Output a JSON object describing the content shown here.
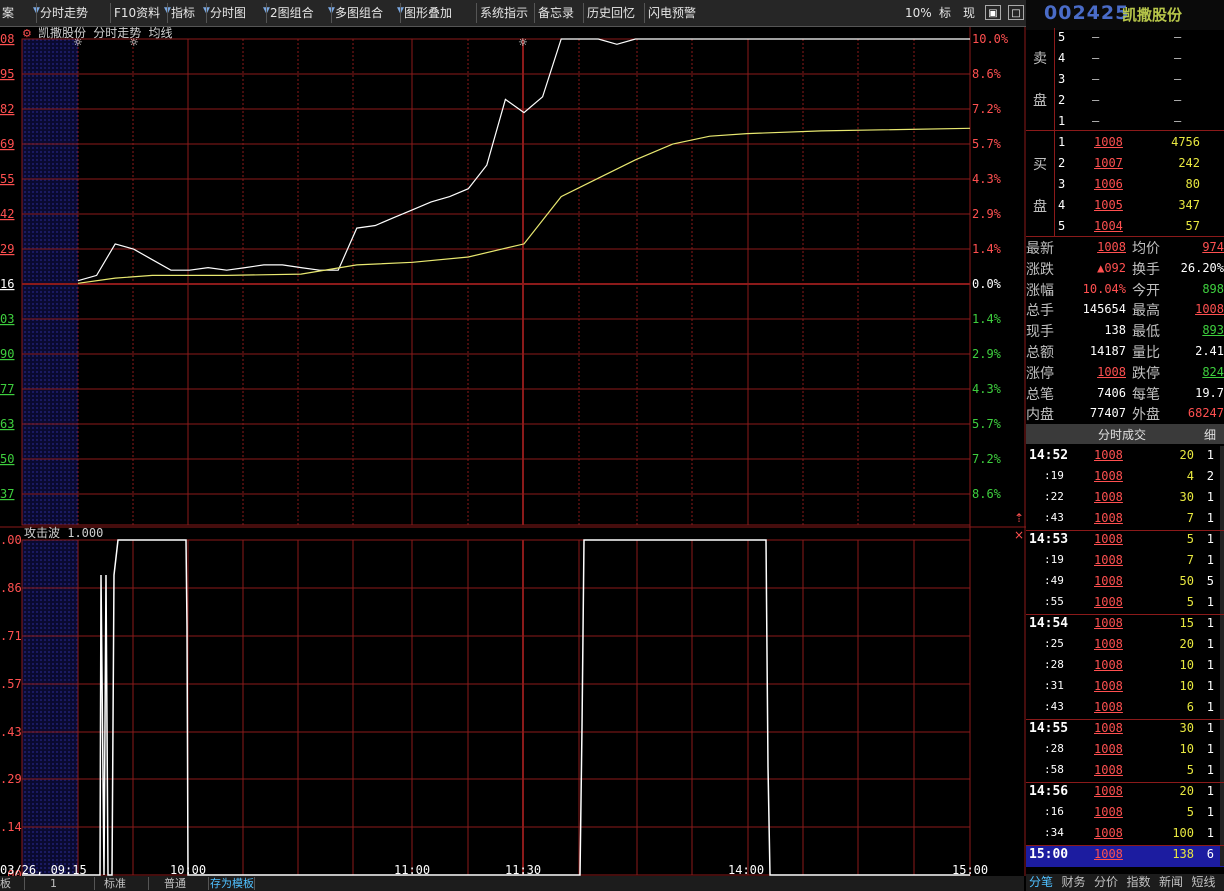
{
  "toolbar": {
    "items": [
      "案",
      "分时走势",
      "F10资料",
      "指标",
      "分时图",
      "2图组合",
      "多图组合",
      "图形叠加",
      "系统指示",
      "备忘录",
      "历史回忆",
      "闪电预警"
    ],
    "right": [
      "10%",
      "标",
      "现"
    ]
  },
  "stock": {
    "code": "002425",
    "name": "凯撒股份"
  },
  "chart": {
    "title": "凯撒股份 分时走势  均线",
    "left_prices": [
      "08",
      "95",
      "82",
      "69",
      "55",
      "42",
      "29",
      "16",
      "03",
      "90",
      "77",
      "63",
      "50",
      "37"
    ],
    "right_pcts": [
      "10.0%",
      "8.6%",
      "7.2%",
      "5.7%",
      "4.3%",
      "2.9%",
      "1.4%",
      "0.0%",
      "1.4%",
      "2.9%",
      "4.3%",
      "5.7%",
      "7.2%",
      "8.6%"
    ],
    "indicator_title": "攻击波  1.000",
    "ind_labels": [
      ".00",
      ".86",
      ".71",
      ".57",
      ".43",
      ".29",
      ".14",
      ".00"
    ],
    "date_label": "03/26, 09:15",
    "times": [
      "10:00",
      "11:00",
      "11:30",
      "14:00",
      "15:00"
    ]
  },
  "chart_data": {
    "type": "line",
    "series": [
      {
        "name": "凯撒股份",
        "x": [
          0,
          5,
          10,
          15,
          20,
          25,
          30,
          35,
          40,
          45,
          50,
          55,
          60,
          65,
          70,
          75,
          80,
          85,
          90,
          95,
          100,
          105,
          110,
          115,
          120,
          125,
          130,
          135,
          140,
          145,
          150,
          155,
          160,
          165,
          170,
          175,
          180,
          185,
          190,
          195,
          200,
          205,
          210,
          215,
          220,
          225,
          230,
          235,
          240
        ],
        "y": [
          9.16,
          9.18,
          9.3,
          9.28,
          9.24,
          9.2,
          9.2,
          9.21,
          9.2,
          9.21,
          9.22,
          9.22,
          9.21,
          9.2,
          9.2,
          9.36,
          9.37,
          9.4,
          9.43,
          9.46,
          9.48,
          9.51,
          9.6,
          9.85,
          9.8,
          9.86,
          10.08,
          10.08,
          10.08,
          10.06,
          10.08,
          10.08,
          10.08,
          10.08,
          10.08,
          10.08,
          10.08,
          10.08,
          10.08,
          10.08,
          10.08,
          10.08,
          10.08,
          10.08,
          10.08,
          10.08,
          10.08,
          10.08,
          10.08
        ]
      },
      {
        "name": "均线",
        "x": [
          0,
          10,
          20,
          40,
          60,
          75,
          90,
          105,
          120,
          130,
          140,
          150,
          160,
          170,
          180,
          200,
          240
        ],
        "y": [
          9.15,
          9.17,
          9.18,
          9.18,
          9.185,
          9.22,
          9.23,
          9.25,
          9.3,
          9.48,
          9.55,
          9.62,
          9.68,
          9.71,
          9.72,
          9.73,
          9.74
        ]
      }
    ],
    "xlabel": "",
    "ylabel": "",
    "ylim": [
      8.23,
      10.08
    ]
  },
  "order_book": {
    "sell_label": [
      "卖",
      "盘"
    ],
    "buy_label": [
      "买",
      "盘"
    ],
    "sell": [
      {
        "n": "5",
        "p": "–",
        "v": "–"
      },
      {
        "n": "4",
        "p": "–",
        "v": "–"
      },
      {
        "n": "3",
        "p": "–",
        "v": "–"
      },
      {
        "n": "2",
        "p": "–",
        "v": "–"
      },
      {
        "n": "1",
        "p": "–",
        "v": "–"
      }
    ],
    "buy": [
      {
        "n": "1",
        "p": "1008",
        "v": "4756"
      },
      {
        "n": "2",
        "p": "1007",
        "v": "242"
      },
      {
        "n": "3",
        "p": "1006",
        "v": "80"
      },
      {
        "n": "4",
        "p": "1005",
        "v": "347"
      },
      {
        "n": "5",
        "p": "1004",
        "v": "57"
      }
    ]
  },
  "stats": [
    {
      "l1": "最新",
      "v1": "1008",
      "l2": "均价",
      "v2": "974"
    },
    {
      "l1": "涨跌",
      "v1": "▲092",
      "l2": "换手",
      "v2": "26.20%"
    },
    {
      "l1": "涨幅",
      "v1": "10.04%",
      "l2": "今开",
      "v2": "898"
    },
    {
      "l1": "总手",
      "v1": "145654",
      "l2": "最高",
      "v2": "1008"
    },
    {
      "l1": "现手",
      "v1": "138",
      "l2": "最低",
      "v2": "893"
    },
    {
      "l1": "总额",
      "v1": "14187",
      "l2": "量比",
      "v2": "2.41"
    },
    {
      "l1": "涨停",
      "v1": "1008",
      "l2": "跌停",
      "v2": "824"
    },
    {
      "l1": "总笔",
      "v1": "7406",
      "l2": "每笔",
      "v2": "19.7"
    },
    {
      "l1": "内盘",
      "v1": "77407",
      "l2": "外盘",
      "v2": "68247"
    }
  ],
  "ticks_header": {
    "title": "分时成交",
    "detail": "细"
  },
  "ticks": [
    {
      "t": "14:52",
      "p": "1008",
      "v": "20",
      "c": "1",
      "major": true
    },
    {
      "t": ":19",
      "p": "1008",
      "v": "4",
      "c": "2"
    },
    {
      "t": ":22",
      "p": "1008",
      "v": "30",
      "c": "1"
    },
    {
      "t": ":43",
      "p": "1008",
      "v": "7",
      "c": "1"
    },
    {
      "t": "14:53",
      "p": "1008",
      "v": "5",
      "c": "1",
      "major": true
    },
    {
      "t": ":19",
      "p": "1008",
      "v": "7",
      "c": "1"
    },
    {
      "t": ":49",
      "p": "1008",
      "v": "50",
      "c": "5"
    },
    {
      "t": ":55",
      "p": "1008",
      "v": "5",
      "c": "1"
    },
    {
      "t": "14:54",
      "p": "1008",
      "v": "15",
      "c": "1",
      "major": true
    },
    {
      "t": ":25",
      "p": "1008",
      "v": "20",
      "c": "1"
    },
    {
      "t": ":28",
      "p": "1008",
      "v": "10",
      "c": "1"
    },
    {
      "t": ":31",
      "p": "1008",
      "v": "10",
      "c": "1"
    },
    {
      "t": ":43",
      "p": "1008",
      "v": "6",
      "c": "1"
    },
    {
      "t": "14:55",
      "p": "1008",
      "v": "30",
      "c": "1",
      "major": true
    },
    {
      "t": ":28",
      "p": "1008",
      "v": "10",
      "c": "1"
    },
    {
      "t": ":58",
      "p": "1008",
      "v": "5",
      "c": "1"
    },
    {
      "t": "14:56",
      "p": "1008",
      "v": "20",
      "c": "1",
      "major": true
    },
    {
      "t": ":16",
      "p": "1008",
      "v": "5",
      "c": "1"
    },
    {
      "t": ":34",
      "p": "1008",
      "v": "100",
      "c": "1"
    },
    {
      "t": "15:00",
      "p": "1008",
      "v": "138",
      "c": "6",
      "major": true,
      "selected": true
    }
  ],
  "bottom_tabs": [
    "板",
    "1",
    "标准",
    "普通",
    "存为模板"
  ],
  "right_tabs": [
    "分笔",
    "财务",
    "分价",
    "指数",
    "新闻",
    "短线"
  ],
  "colors": {
    "up": "#ff5050",
    "down": "#3ecf3e",
    "grid": "#8b1a1a",
    "price_line": "#ffffff",
    "avg_line": "#e8e870",
    "volume": "#e8e840",
    "highlight": "#1c1ca0"
  }
}
